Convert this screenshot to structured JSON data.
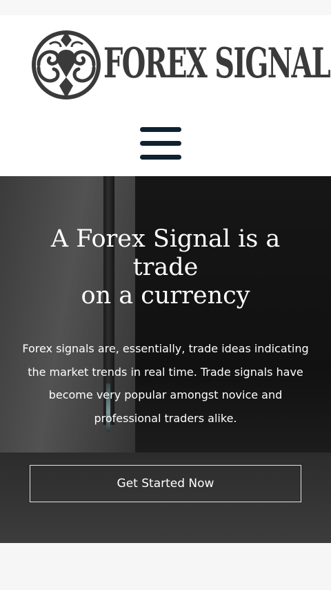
{
  "brand": {
    "logo_text": "FOREX SIGNAL",
    "logo_color": "#3a3a3a"
  },
  "header": {
    "menu_icon": "hamburger-menu-icon",
    "menu_color": "#0e2230"
  },
  "hero": {
    "title_line1": "A Forex Signal is a trade",
    "title_line2": "on a currency",
    "description": "Forex signals are, essentially, trade ideas indicating the market trends in real time. Trade signals have become very popular amongst novice and professional traders alike.",
    "cta_label": "Get Started Now"
  }
}
